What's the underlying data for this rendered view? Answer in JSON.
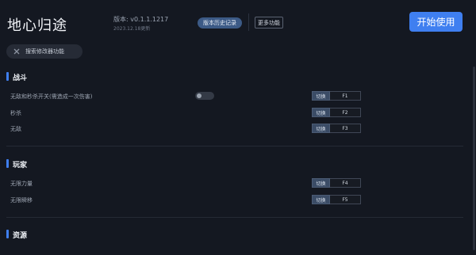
{
  "header": {
    "title": "地心归途",
    "version": "版本: v0.1.1.1217",
    "date": "2023.12.18更新",
    "history_btn": "版本历史记录",
    "more_btn": "更多功能",
    "start_btn": "开始使用"
  },
  "search": {
    "label": "搜索修改器功能",
    "icon": "close-x-icon"
  },
  "sections": [
    {
      "title": "战斗",
      "rows": [
        {
          "label": "无敌和秒杀开关(需造成一次伤害)",
          "switch": "切换",
          "key": "F1",
          "toggle": "off"
        },
        {
          "label": "秒杀",
          "switch": "切换",
          "key": "F2"
        },
        {
          "label": "无敌",
          "switch": "切换",
          "key": "F3"
        }
      ]
    },
    {
      "title": "玩家",
      "rows": [
        {
          "label": "无限力量",
          "switch": "切换",
          "key": "F4"
        },
        {
          "label": "无限瞬移",
          "switch": "切换",
          "key": "F5"
        }
      ]
    },
    {
      "title": "资源",
      "rows": []
    }
  ],
  "colors": {
    "accent": "#3f7ff0",
    "background": "#141821"
  }
}
